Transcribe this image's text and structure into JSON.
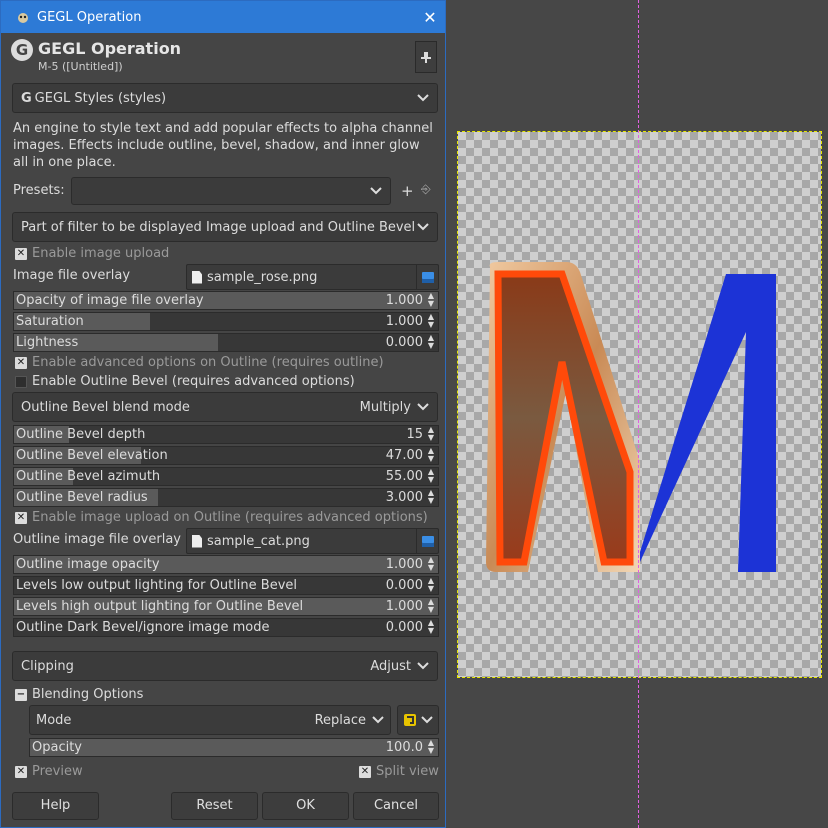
{
  "window": {
    "title": "GEGL Operation",
    "close_glyph": "✕"
  },
  "header": {
    "title": "GEGL Operation",
    "subtitle": "M-5 ([Untitled])",
    "logo_letter": "G",
    "logo_icon": "gegl-logo-icon",
    "pin_icon": "pin-icon"
  },
  "operation": {
    "selected": "GEGL Styles (styles)"
  },
  "description": "An engine to style text and add popular effects to alpha channel images. Effects include outline, bevel, shadow, and inner glow all in one place.",
  "presets": {
    "label": "Presets:",
    "value": "",
    "add_icon": "+",
    "manage_icon": "⎆"
  },
  "part_combo": {
    "label": "Part of filter to be displayed Image upload and Outline Bevel"
  },
  "enable_image_upload": {
    "label": "Enable image upload",
    "checked": true
  },
  "image_file_overlay": {
    "label": "Image file overlay",
    "file": "sample_rose.png"
  },
  "sliders1": [
    {
      "label": "Opacity of image file overlay",
      "value": "1.000",
      "fraction": 1.0
    },
    {
      "label": "Saturation",
      "value": "1.000",
      "fraction": 0.32
    },
    {
      "label": "Lightness",
      "value": "0.000",
      "fraction": 0.48
    }
  ],
  "enable_adv_outline": {
    "label": "Enable advanced options on Outline (requires outline)",
    "checked": true
  },
  "enable_outline_bevel": {
    "label": "Enable Outline Bevel (requires advanced options)",
    "checked": false
  },
  "blend_mode": {
    "label": "Outline Bevel blend mode",
    "value": "Multiply"
  },
  "sliders2": [
    {
      "label": "Outline Bevel depth",
      "value": "15",
      "fraction": 0.13
    },
    {
      "label": "Outline Bevel elevation",
      "value": "47.00",
      "fraction": 0.3
    },
    {
      "label": "Outline Bevel azimuth",
      "value": "55.00",
      "fraction": 0.14
    },
    {
      "label": "Outline Bevel radius",
      "value": "3.000",
      "fraction": 0.34
    }
  ],
  "enable_upload_outline": {
    "label": "Enable image upload on Outline (requires advanced options)",
    "checked": true
  },
  "outline_file": {
    "label": "Outline image file overlay",
    "file": "sample_cat.png"
  },
  "sliders3": [
    {
      "label": "Outline image opacity",
      "value": "1.000",
      "fraction": 1.0
    },
    {
      "label": "Levels low output lighting for Outline Bevel",
      "value": "0.000",
      "fraction": 0.0
    },
    {
      "label": "Levels high output lighting for Outline Bevel",
      "value": "1.000",
      "fraction": 1.0
    },
    {
      "label": "Outline Dark Bevel/ignore image mode",
      "value": "0.000",
      "fraction": 0.0
    }
  ],
  "clipping": {
    "label": "Clipping",
    "value": "Adjust"
  },
  "blending": {
    "label": "Blending Options",
    "collapse_glyph": "−",
    "mode_label": "Mode",
    "mode_value": "Replace",
    "opacity_label": "Opacity",
    "opacity_value": "100.0",
    "opacity_fraction": 1.0
  },
  "preview": {
    "label": "Preview",
    "checked": true
  },
  "split_view": {
    "label": "Split view",
    "checked": true
  },
  "buttons": {
    "help": "Help",
    "reset": "Reset",
    "ok": "OK",
    "cancel": "Cancel"
  },
  "colors": {
    "titlebar": "#2d7ad6",
    "letter_blue": "#1c33d6",
    "letter_orange": "#e0521a"
  }
}
